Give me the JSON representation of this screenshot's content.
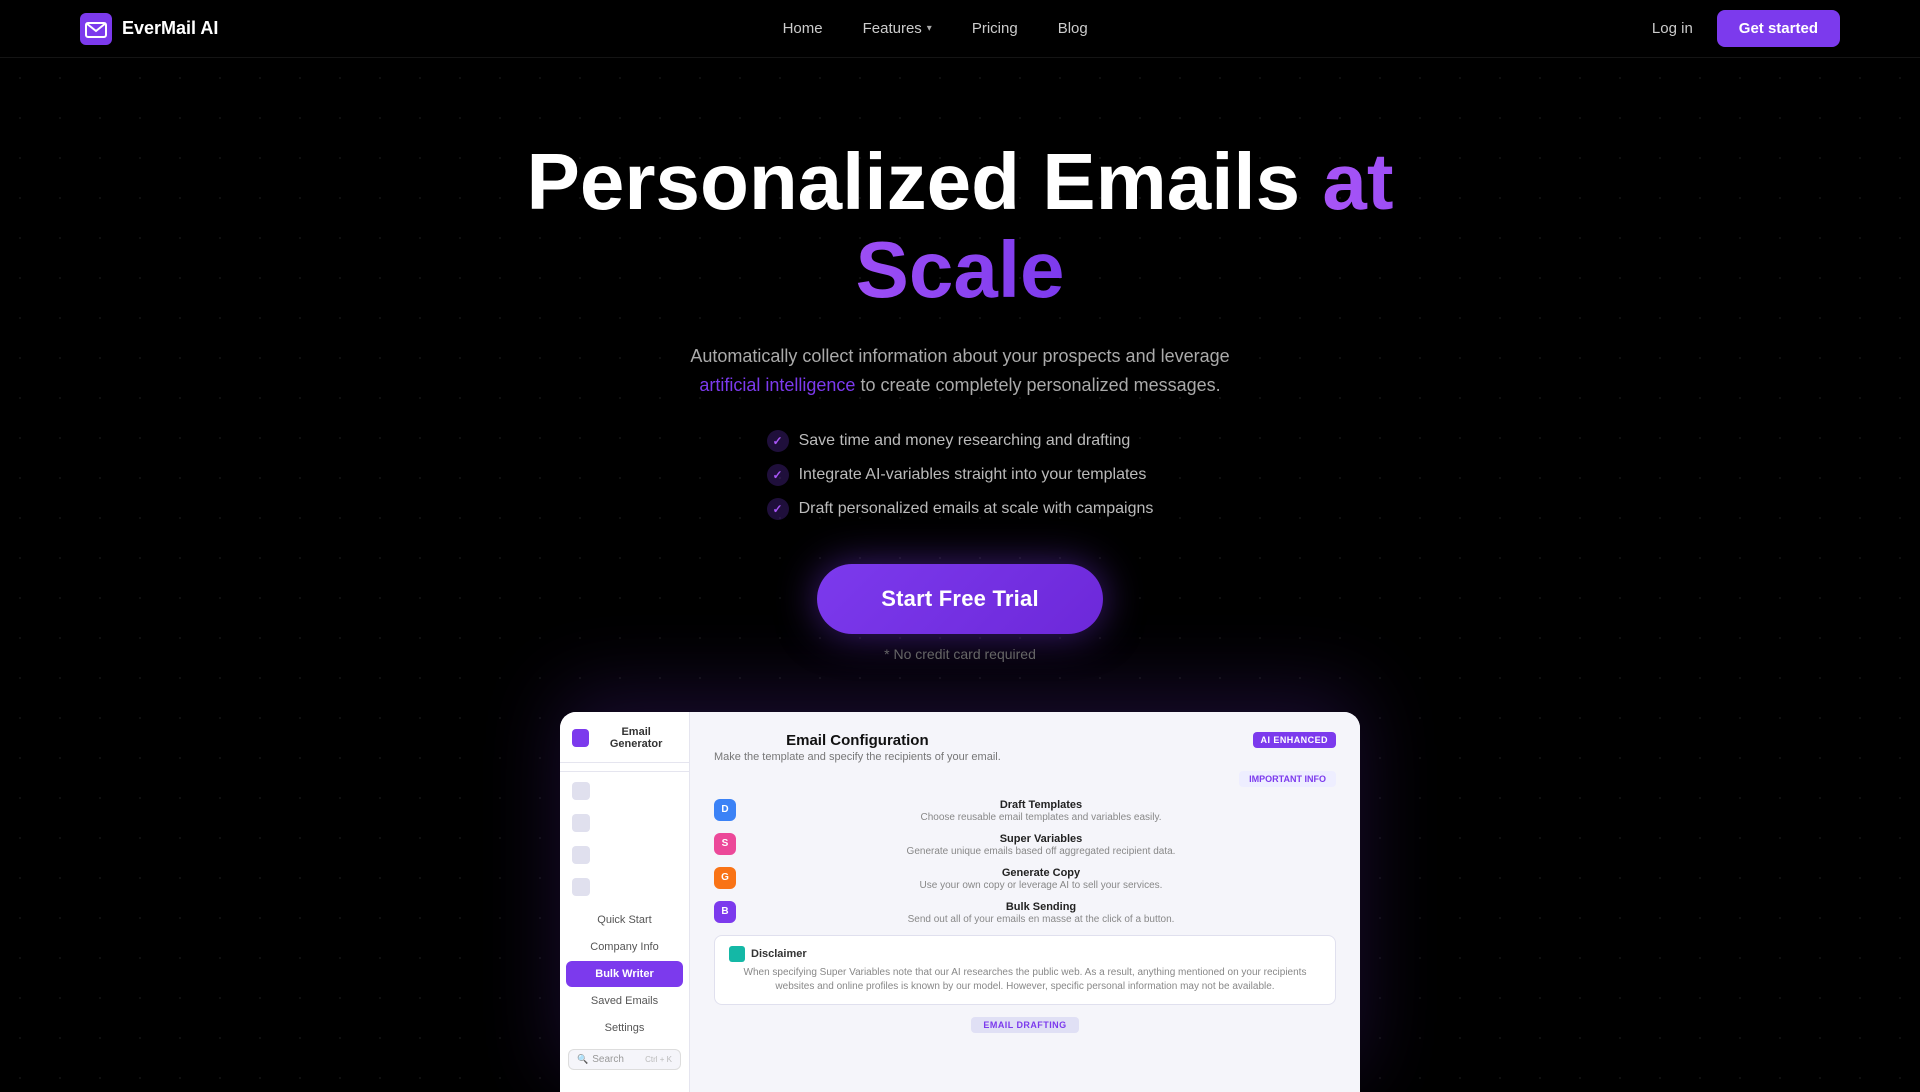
{
  "nav": {
    "logo_text": "EverMail AI",
    "links": [
      {
        "label": "Home",
        "id": "home"
      },
      {
        "label": "Features",
        "id": "features",
        "has_dropdown": true
      },
      {
        "label": "Pricing",
        "id": "pricing"
      },
      {
        "label": "Blog",
        "id": "blog"
      }
    ],
    "login_label": "Log in",
    "cta_label": "Get started"
  },
  "hero": {
    "title_part1": "Personalized Emails ",
    "title_part2": "at Scale",
    "subtitle_before": "Automatically collect information about your prospects and leverage ",
    "subtitle_link": "artificial intelligence",
    "subtitle_after": " to create completely personalized messages.",
    "checklist": [
      "Save time and money researching and drafting",
      "Integrate AI-variables straight into your templates",
      "Draft personalized emails at scale with campaigns"
    ],
    "cta_button": "Start Free Trial",
    "cta_note": "* No credit card required"
  },
  "app_preview": {
    "sidebar": {
      "logo_text": "Email Generator",
      "items": [
        {
          "label": "Quick Start",
          "active": false
        },
        {
          "label": "Company Info",
          "active": false
        },
        {
          "label": "Bulk Writer",
          "active": true
        },
        {
          "label": "Saved Emails",
          "active": false
        },
        {
          "label": "Settings",
          "active": false
        }
      ],
      "search_placeholder": "Search"
    },
    "main": {
      "title": "Email Configuration",
      "subtitle": "Make the template and specify the recipients of your email.",
      "badge_ai": "AI ENHANCED",
      "badge_important": "IMPORTANT INFO",
      "features": [
        {
          "name": "Draft Templates",
          "desc": "Choose reusable email templates and variables easily.",
          "color": "blue"
        },
        {
          "name": "Super Variables",
          "desc": "Generate unique emails based off aggregated recipient data.",
          "color": "pink"
        },
        {
          "name": "Generate Copy",
          "desc": "Use your own copy or leverage AI to sell your services.",
          "color": "orange"
        },
        {
          "name": "Bulk Sending",
          "desc": "Send out all of your emails en masse at the click of a button.",
          "color": "violet"
        }
      ],
      "disclaimer": {
        "title": "Disclaimer",
        "text": "When specifying Super Variables note that our AI researches the public web. As a result, anything mentioned on your recipients websites and online profiles is known by our model. However, specific personal information may not be available."
      },
      "bottom_badge": "EMAIL DRAFTING"
    }
  },
  "colors": {
    "brand_purple": "#7c3aed",
    "hero_purple": "#a855f7"
  }
}
